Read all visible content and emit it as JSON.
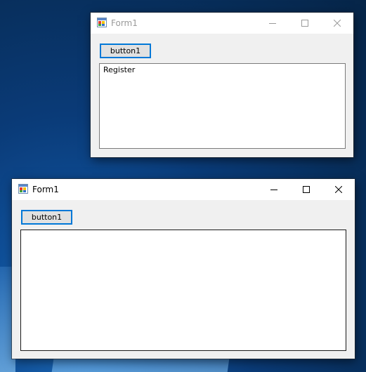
{
  "windows": {
    "back": {
      "title": "Form1",
      "button_label": "button1",
      "textbox_value": "Register"
    },
    "front": {
      "title": "Form1",
      "button_label": "button1",
      "textbox_value": ""
    }
  },
  "icons": {
    "app": "form-app-icon",
    "minimize": "minimize-icon",
    "maximize": "maximize-icon",
    "close": "close-icon"
  },
  "colors": {
    "accent": "#0078d7",
    "window_bg": "#f0f0f0",
    "titlebar_bg": "#ffffff",
    "inactive_title": "#9a9a9a"
  }
}
